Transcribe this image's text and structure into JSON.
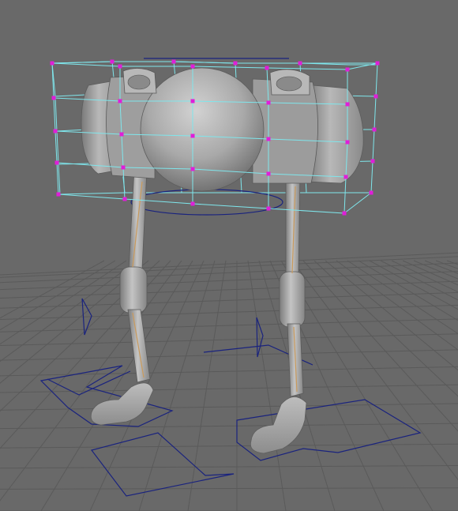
{
  "viewport": {
    "background": "#696969",
    "grid_color": "#595959",
    "grid_major_color": "#4a4a4a",
    "lattice_color": "#7fe6ec",
    "lattice_point_color": "#e01ed8",
    "controller_color": "#1a237e",
    "body_color": "#a9a9a9",
    "bone_color": "#c99a5c"
  }
}
